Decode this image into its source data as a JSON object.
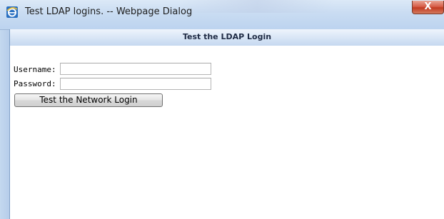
{
  "window": {
    "title": "Test LDAP logins. -- Webpage Dialog",
    "close_label": "X"
  },
  "header": {
    "title": "Test the LDAP Login"
  },
  "form": {
    "username_label": "Username:",
    "username_value": "",
    "password_label": "Password:",
    "password_value": "",
    "submit_label": "Test the Network Login"
  },
  "icons": {
    "app": "internet-explorer-icon",
    "close": "close-icon"
  }
}
